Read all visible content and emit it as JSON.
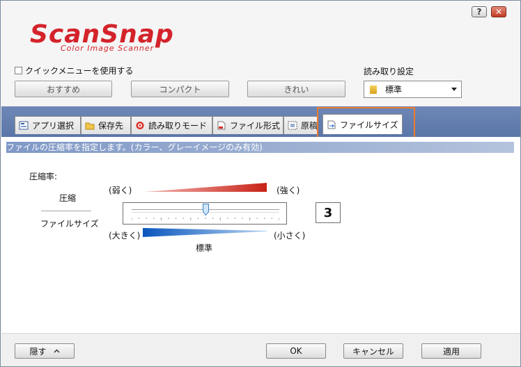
{
  "window": {
    "help_button": "?",
    "close_button": "✕"
  },
  "logo": {
    "brand": "ScanSnap",
    "tagline": "Color Image Scanner"
  },
  "quick_menu": {
    "label": "クイックメニューを使用する",
    "checked": false
  },
  "presets": {
    "recommended": "おすすめ",
    "compact": "コンパクト",
    "clean": "きれい"
  },
  "read_settings": {
    "label": "読み取り設定",
    "selected": "標準"
  },
  "tabs": [
    {
      "label": "アプリ選択",
      "icon": "app-select-icon"
    },
    {
      "label": "保存先",
      "icon": "folder-icon"
    },
    {
      "label": "読み取りモード",
      "icon": "scan-mode-icon"
    },
    {
      "label": "ファイル形式",
      "icon": "file-format-icon"
    },
    {
      "label": "原稿",
      "icon": "document-icon"
    },
    {
      "label": "ファイルサイズ",
      "icon": "file-size-icon",
      "active": true
    }
  ],
  "file_size": {
    "description": "ファイルの圧縮率を指定します。(カラー、グレーイメージのみ有効)",
    "compression_label": "圧縮率:",
    "compression_row": "圧縮",
    "filesize_row": "ファイルサイズ",
    "weak": "(弱く)",
    "strong": "(強く)",
    "large": "(大きく)",
    "small": "(小さく)",
    "standard": "標準",
    "value": "3",
    "slider_level": 3,
    "slider_max": 5
  },
  "footer": {
    "hide": "隠す",
    "ok": "OK",
    "cancel": "キャンセル",
    "apply": "適用"
  },
  "colors": {
    "highlight": "#f07a2a",
    "tab_band": "#5a76a8",
    "compression_red": "#cc2a1f",
    "filesize_blue": "#1565c8"
  }
}
